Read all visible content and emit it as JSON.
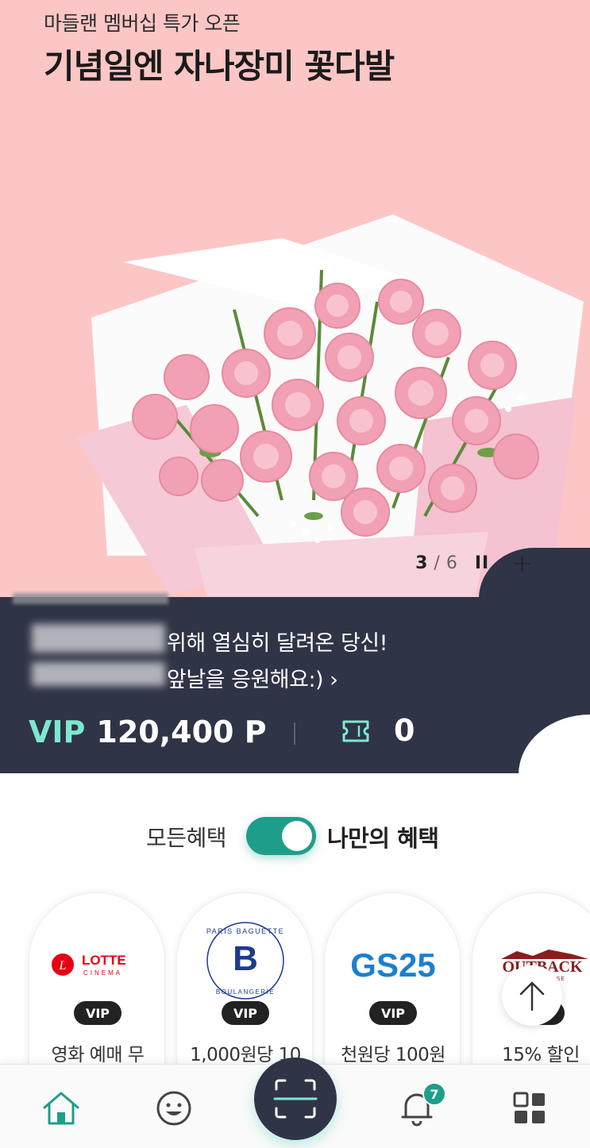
{
  "hero": {
    "subtitle": "마들랜 멤버십 특가 오픈",
    "title": "기념일엔 자나장미 꽃다발",
    "pager": {
      "current": "3",
      "separator": "/",
      "total": "6",
      "pause": "II",
      "more": "+"
    }
  },
  "member": {
    "message_line1": "위해 열심히 달려온 당신!",
    "message_line2": "앞날을 응원해요:) ›",
    "grade": "VIP",
    "points": "120,400 P",
    "ticket_count": "0"
  },
  "toggle": {
    "left_label": "모든혜택",
    "right_label": "나만의 혜택",
    "state": "on"
  },
  "cards": [
    {
      "brand": "LOTTE",
      "brand_sub": "CINEMA",
      "badge": "VIP",
      "desc": "영화 예매 무"
    },
    {
      "brand": "PARIS BAGUETTE",
      "brand_sub": "BOULANGERIE",
      "badge": "VIP",
      "desc": "1,000원당 10"
    },
    {
      "brand": "GS25",
      "badge": "VIP",
      "desc": "천원당 100원"
    },
    {
      "brand": "OUTBACK",
      "brand_sub": "STEAKHOUSE",
      "badge": "VIP",
      "desc": "15% 할인"
    }
  ],
  "nav": {
    "items": [
      "home-icon",
      "smile-icon",
      "scan-icon",
      "bell-icon",
      "grid-icon"
    ],
    "notification_count": "7"
  },
  "colors": {
    "hero_bg": "#fcc6c6",
    "panel_bg": "#2f3446",
    "accent": "#1e9e8a",
    "vip_text": "#7ee8cf"
  }
}
